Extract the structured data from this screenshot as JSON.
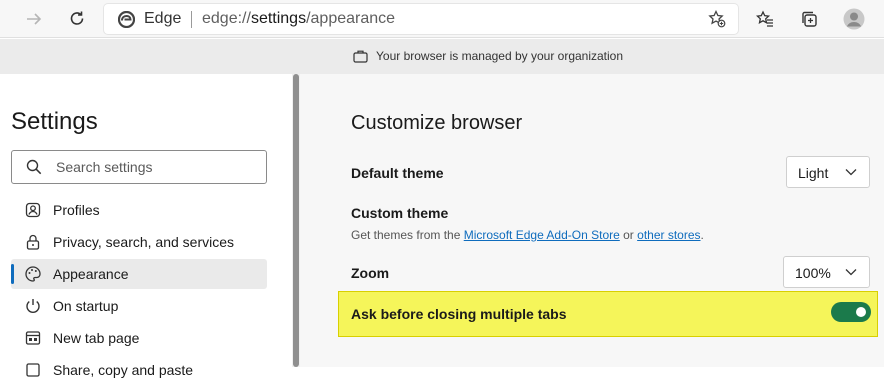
{
  "toolbar": {
    "address_brand": "Edge",
    "url_prefix": "edge://",
    "url_host": "settings",
    "url_path": "/appearance"
  },
  "banner": {
    "text": "Your browser is managed by your organization"
  },
  "sidebar": {
    "title": "Settings",
    "search_placeholder": "Search settings",
    "items": [
      {
        "label": "Profiles",
        "icon": "profiles-icon"
      },
      {
        "label": "Privacy, search, and services",
        "icon": "lock-icon"
      },
      {
        "label": "Appearance",
        "icon": "palette-icon",
        "active": true
      },
      {
        "label": "On startup",
        "icon": "power-icon"
      },
      {
        "label": "New tab page",
        "icon": "new-tab-icon"
      },
      {
        "label": "Share, copy and paste",
        "icon": "share-icon"
      }
    ]
  },
  "main": {
    "heading": "Customize browser",
    "default_theme": {
      "label": "Default theme",
      "value": "Light"
    },
    "custom_theme": {
      "label": "Custom theme",
      "desc_prefix": "Get themes from the ",
      "link_store": "Microsoft Edge Add-On Store",
      "desc_mid": " or ",
      "link_other": "other stores",
      "desc_suffix": "."
    },
    "zoom": {
      "label": "Zoom",
      "value": "100%"
    },
    "ask_close_tabs": {
      "label": "Ask before closing multiple tabs",
      "enabled": true
    }
  },
  "colors": {
    "accent": "#0f6cbd",
    "highlight": "#f5f55a",
    "toggle_on": "#1b7a4b"
  }
}
